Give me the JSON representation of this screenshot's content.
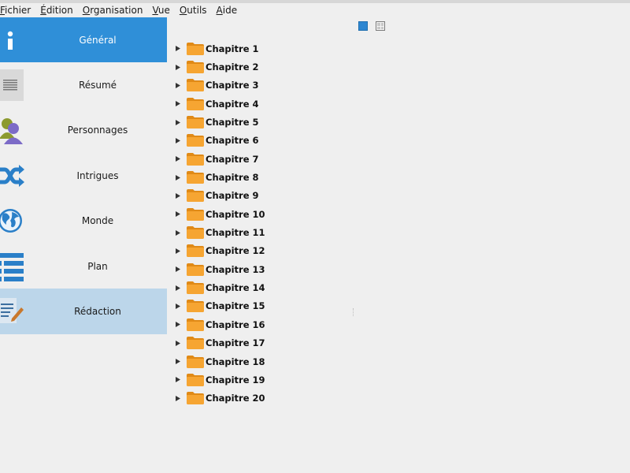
{
  "menubar": {
    "items": [
      {
        "mnemonic": "F",
        "rest": "ichier"
      },
      {
        "mnemonic": "É",
        "rest": "dition"
      },
      {
        "mnemonic": "O",
        "rest": "rganisation"
      },
      {
        "mnemonic": "V",
        "rest": "ue"
      },
      {
        "mnemonic": "O",
        "rest": "utils"
      },
      {
        "mnemonic": "A",
        "rest": "ide"
      }
    ]
  },
  "sidebar": {
    "items": [
      {
        "label": "Général",
        "icon": "info-icon",
        "state": "active"
      },
      {
        "label": "Résumé",
        "icon": "summary-icon",
        "state": "normal"
      },
      {
        "label": "Personnages",
        "icon": "characters-icon",
        "state": "normal"
      },
      {
        "label": "Intrigues",
        "icon": "plots-icon",
        "state": "normal"
      },
      {
        "label": "Monde",
        "icon": "globe-icon",
        "state": "normal"
      },
      {
        "label": "Plan",
        "icon": "outline-icon",
        "state": "normal"
      },
      {
        "label": "Rédaction",
        "icon": "editor-icon",
        "state": "selected"
      }
    ]
  },
  "tree": {
    "chapters": [
      "Chapitre 1",
      "Chapitre 2",
      "Chapitre 3",
      "Chapitre 4",
      "Chapitre 5",
      "Chapitre 6",
      "Chapitre 7",
      "Chapitre 8",
      "Chapitre 9",
      "Chapitre 10",
      "Chapitre 11",
      "Chapitre 12",
      "Chapitre 13",
      "Chapitre 14",
      "Chapitre 15",
      "Chapitre 16",
      "Chapitre 17",
      "Chapitre 18",
      "Chapitre 19",
      "Chapitre 20"
    ]
  },
  "colors": {
    "active_bg": "#2f8fd8",
    "selected_bg": "#bcd6ea",
    "folder": "#f6a532",
    "icon_blue": "#2a7fc8"
  }
}
